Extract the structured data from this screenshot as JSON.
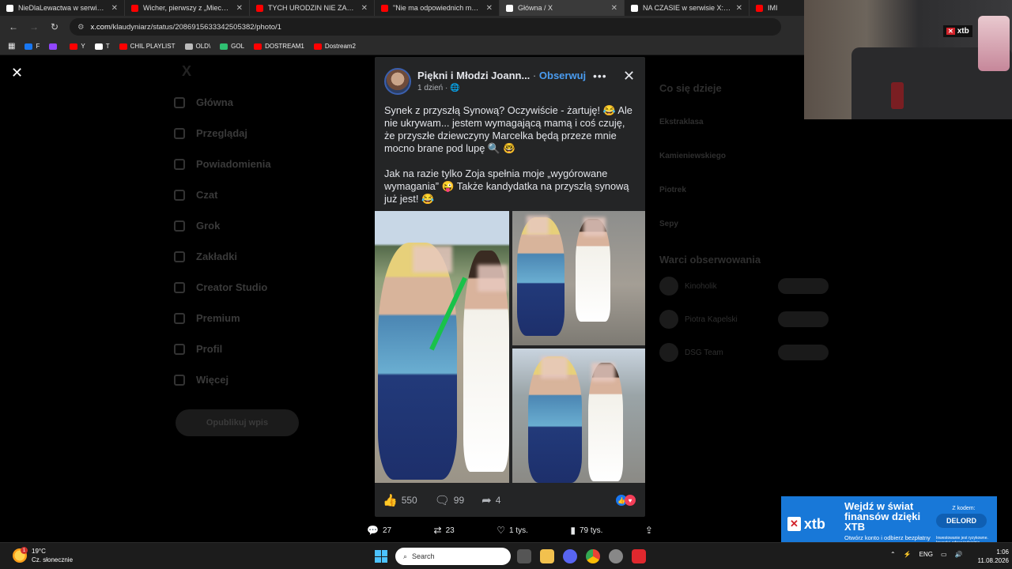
{
  "browser": {
    "tabs": [
      {
        "title": "NieDlaLewactwa w serwisie X: „",
        "color": "#ffffff",
        "active": false
      },
      {
        "title": "Wicher, pierwszy z „Mieczników",
        "color": "#ff0000",
        "active": false
      },
      {
        "title": "TYCH URODZIN NIE ZAPOMNI",
        "color": "#ff0000",
        "active": false
      },
      {
        "title": "\"Nie ma odpowiednich mężczy",
        "color": "#ff0000",
        "active": false
      },
      {
        "title": "Główna / X",
        "color": "#ffffff",
        "active": true
      },
      {
        "title": "NA CZASIE w serwisie X: 🇺🇸Inf",
        "color": "#ffffff",
        "active": false
      },
      {
        "title": "IMI",
        "color": "#ff0000",
        "active": false
      }
    ],
    "url_host": "x.com",
    "url_path": "/klaudyniarz/status/2086915633342505382/photo/1",
    "bookmarks": [
      {
        "label": "F",
        "color": "#1877f2"
      },
      {
        "label": "",
        "color": "#9146ff"
      },
      {
        "label": "Y",
        "color": "#ff0000"
      },
      {
        "label": "T",
        "color": "#ffffff"
      },
      {
        "label": "CHIL PLAYLIST",
        "color": "#ff0000"
      },
      {
        "label": "OLD\\",
        "color": "#bbbbbb"
      },
      {
        "label": "GOL",
        "color": "#2fbf71"
      },
      {
        "label": "DOSTREAM1",
        "color": "#ff0000"
      },
      {
        "label": "Dostream2",
        "color": "#ff0000"
      }
    ]
  },
  "x_background": {
    "nav": [
      "Główna",
      "Przeglądaj",
      "Powiadomienia",
      "Czat",
      "Grok",
      "Zakładki",
      "Creator Studio",
      "Premium",
      "Profil",
      "Więcej"
    ],
    "post_button": "Opublikuj wpis",
    "right_heading": "Co się dzieje",
    "trends": [
      "Ekstraklasa",
      "Kamieniewskiego",
      "Piotrek",
      "Sepy"
    ],
    "follow_heading": "Warci obserwowania",
    "follow": [
      "Kinoholik",
      "Piotra Kapelski",
      "DSG Team"
    ]
  },
  "post": {
    "page_name": "Piękni i Młodzi Joann...",
    "separator": "·",
    "follow_label": "Obserwuj",
    "time": "1 dzień ·",
    "globe_icon": "globe-icon",
    "paragraph1": "Synek z przyszłą Synową? Oczywiście - żartuję! 😂 Ale nie ukrywam... jestem wymagającą mamą i coś czuję, że przyszłe dziewczyny Marcelka będą przeze mnie mocno brane pod lupę 🔍 🤓",
    "paragraph2": "Jak na razie tylko Zoja spełnia moje „wygórowane wymagania” 😜 Także kandydatka na przyszłą synową już jest! 😂",
    "likes": "550",
    "comments": "99",
    "shares": "4"
  },
  "x_actions": {
    "replies": "27",
    "reposts": "23",
    "likes": "1 tys.",
    "views": "79 tys."
  },
  "webcam_overlay": {
    "brand": "xtb"
  },
  "ad": {
    "brand": "xtb",
    "headline": "Wejdź w świat finansów dzięki XTB",
    "sub": "Otwórz konto i odbierz bezpłatny kurs",
    "code_label": "Z kodem:",
    "code": "DELORD",
    "risk": "Inwestowanie jest ryzykowne. Inwestuj odpowiedzialnie."
  },
  "taskbar": {
    "temperature": "19°C",
    "weather": "Cz. słonecznie",
    "weather_badge": "1",
    "search_placeholder": "Search",
    "language": "ENG",
    "time": "1:06",
    "date": "11.08.2026"
  }
}
